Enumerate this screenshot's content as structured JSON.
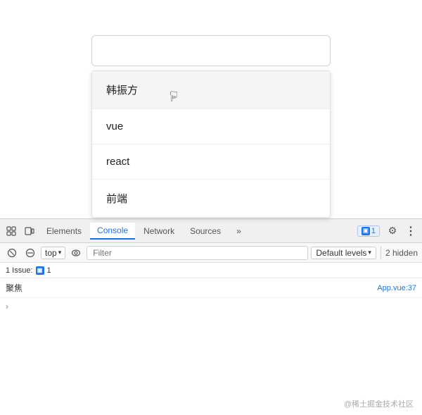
{
  "browser": {
    "input_placeholder": "",
    "input_value": ""
  },
  "dropdown": {
    "items": [
      {
        "id": 1,
        "label": "韩振方",
        "highlighted": true
      },
      {
        "id": 2,
        "label": "vue",
        "highlighted": false
      },
      {
        "id": 3,
        "label": "react",
        "highlighted": false
      },
      {
        "id": 4,
        "label": "前端",
        "highlighted": false
      }
    ]
  },
  "devtools": {
    "tabs": [
      {
        "id": "elements",
        "label": "Elements",
        "active": false
      },
      {
        "id": "console",
        "label": "Console",
        "active": true
      },
      {
        "id": "network",
        "label": "Network",
        "active": false
      },
      {
        "id": "sources",
        "label": "Sources",
        "active": false
      },
      {
        "id": "more",
        "label": "»",
        "active": false
      }
    ],
    "issue_count": "1",
    "second_row": {
      "context": "top",
      "filter_placeholder": "Filter",
      "filter_value": "",
      "levels_label": "Default levels",
      "hidden_count": "2 hidden"
    },
    "issues_bar": {
      "label": "1 Issue:",
      "count": "1"
    },
    "console_entries": [
      {
        "text": "聚焦",
        "link": "App.vue:37"
      }
    ]
  },
  "watermark": "@稀土掘金技术社区"
}
